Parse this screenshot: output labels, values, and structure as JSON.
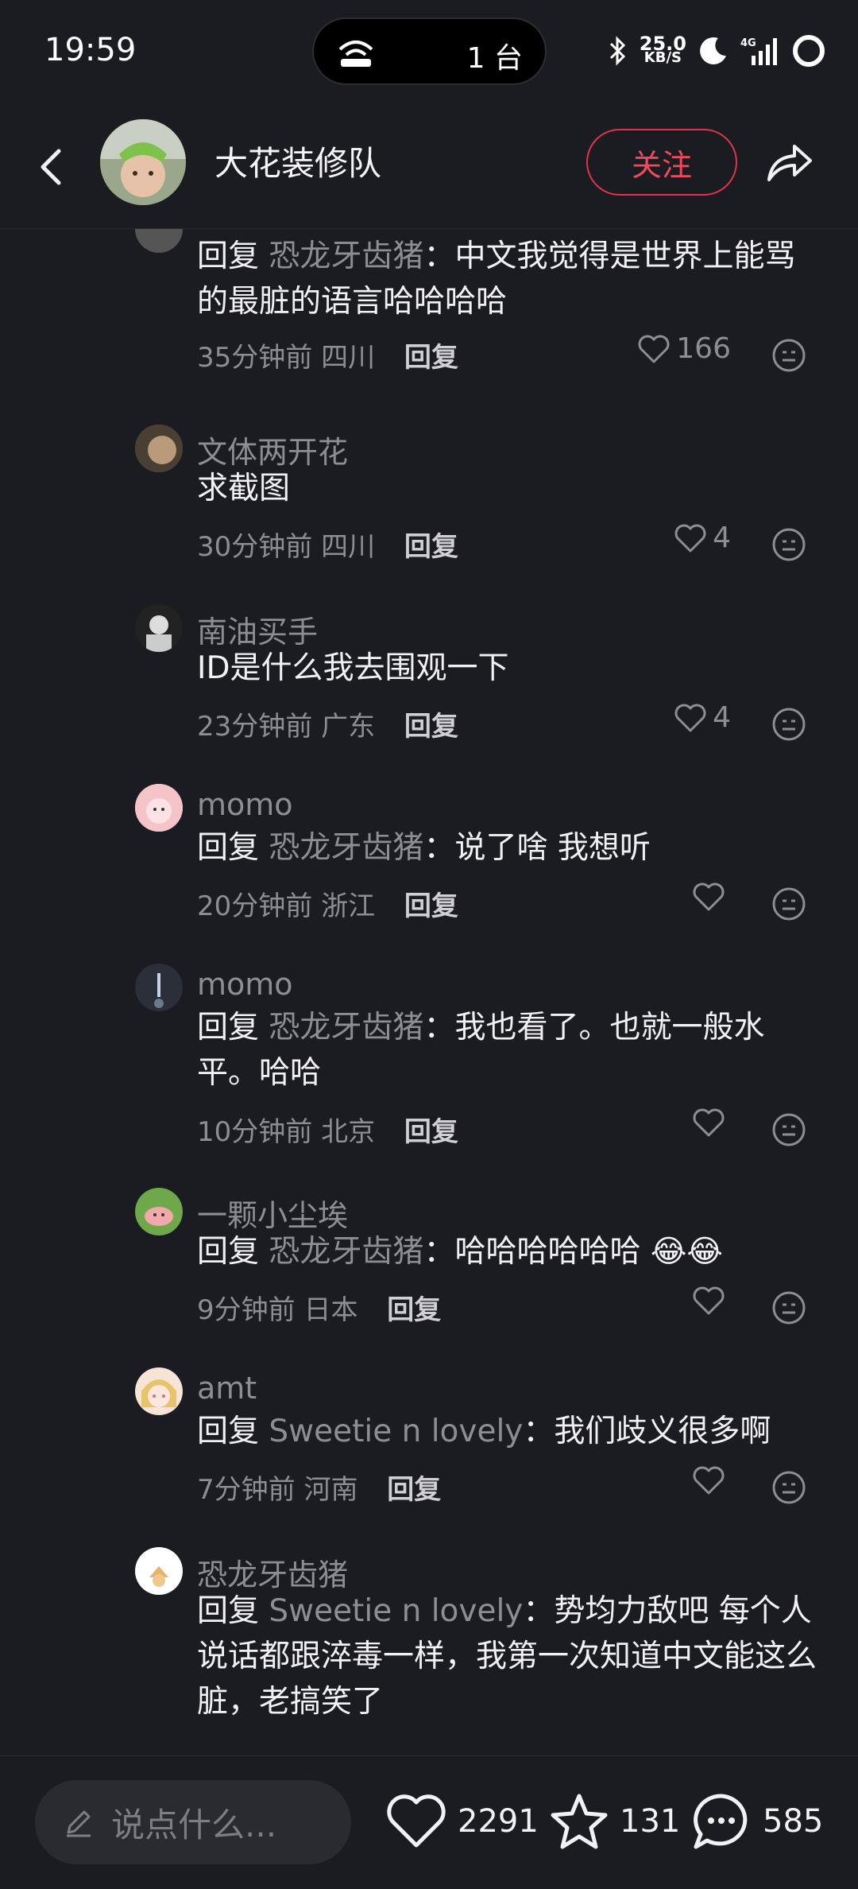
{
  "status": {
    "time": "19:59",
    "island_text": "1 台",
    "speed_value": "25.0",
    "speed_unit": "KB/S",
    "network": "4G"
  },
  "header": {
    "name": "大花装修队",
    "follow_label": "关注"
  },
  "comments": [
    {
      "user": "",
      "reply_word": "回复",
      "reply_target": "恐龙牙齿猪",
      "text": "：中文我觉得是世界上能骂的最脏的语言哈哈哈哈",
      "time": "35分钟前",
      "location": "四川",
      "reply_label": "回复",
      "likes": "166"
    },
    {
      "user": "文体两开花",
      "reply_word": "",
      "reply_target": "",
      "text": "求截图",
      "time": "30分钟前",
      "location": "四川",
      "reply_label": "回复",
      "likes": "4"
    },
    {
      "user": "南油买手",
      "reply_word": "",
      "reply_target": "",
      "text": "ID是什么我去围观一下",
      "time": "23分钟前",
      "location": "广东",
      "reply_label": "回复",
      "likes": "4"
    },
    {
      "user": "momo",
      "reply_word": "回复",
      "reply_target": "恐龙牙齿猪",
      "text": "：说了啥 我想听",
      "time": "20分钟前",
      "location": "浙江",
      "reply_label": "回复",
      "likes": ""
    },
    {
      "user": "momo",
      "reply_word": "回复",
      "reply_target": "恐龙牙齿猪",
      "text": "：我也看了。也就一般水平。哈哈",
      "time": "10分钟前",
      "location": "北京",
      "reply_label": "回复",
      "likes": ""
    },
    {
      "user": "一颗小尘埃",
      "reply_word": "回复",
      "reply_target": "恐龙牙齿猪",
      "text": "：哈哈哈哈哈哈 😂😂",
      "time": "9分钟前",
      "location": "日本",
      "reply_label": "回复",
      "likes": ""
    },
    {
      "user": "amt",
      "reply_word": "回复",
      "reply_target": "Sweetie n lovely",
      "text": "：我们歧义很多啊",
      "time": "7分钟前",
      "location": "河南",
      "reply_label": "回复",
      "likes": ""
    },
    {
      "user": "恐龙牙齿猪",
      "reply_word": "回复",
      "reply_target": "Sweetie n lovely",
      "text": "：势均力敌吧 每个人说话都跟淬毒一样，我第一次知道中文能这么脏，老搞笑了",
      "time": "",
      "location": "",
      "reply_label": "",
      "likes": ""
    }
  ],
  "bottom": {
    "placeholder": "说点什么...",
    "likes": "2291",
    "favorites": "131",
    "comments": "585"
  },
  "colors": {
    "background": "#1b1b22",
    "accent": "#e0344b",
    "muted": "#8d8d96"
  },
  "icons": [
    "back-icon",
    "share-icon",
    "heart-icon",
    "emoji-icon",
    "star-icon",
    "comment-icon",
    "pencil-icon",
    "bluetooth-icon",
    "moon-icon",
    "signal-icon",
    "battery-icon"
  ]
}
